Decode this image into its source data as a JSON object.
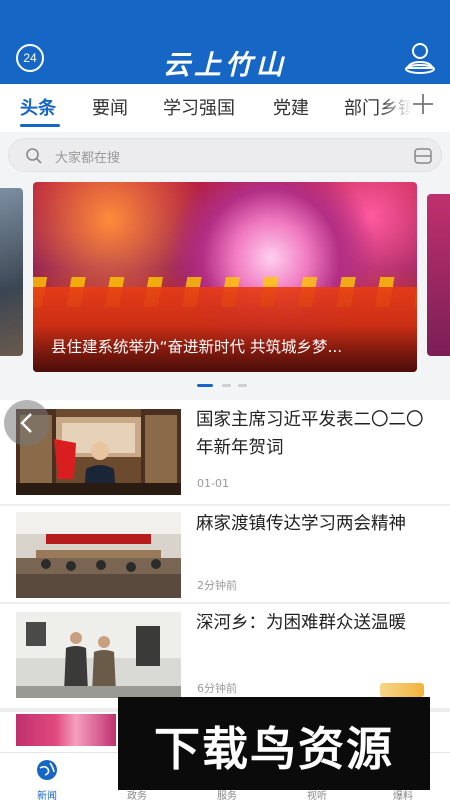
{
  "header": {
    "badge_text": "24",
    "title": "云上竹山",
    "user_icon": "user-profile-icon",
    "bg_color": "#1666c5"
  },
  "tabs": [
    {
      "label": "头条",
      "active": true
    },
    {
      "label": "要闻"
    },
    {
      "label": "学习强国"
    },
    {
      "label": "党建"
    },
    {
      "label": "部门乡镇"
    }
  ],
  "tabs_add_icon": "plus-icon",
  "search": {
    "placeholder": "大家都在搜"
  },
  "banner": {
    "title": "县住建系统举办“奋进新时代 共筑城乡梦...",
    "indicator": {
      "count": 3,
      "active": 0
    }
  },
  "news": [
    {
      "title": "国家主席习近平发表二〇二〇年新年贺词",
      "meta": "01-01"
    },
    {
      "title": "麻家渡镇传达学习两会精神",
      "meta": "2分钟前"
    },
    {
      "title": "深河乡：为困难群众送温暖",
      "meta": "6分钟前"
    }
  ],
  "bottom_nav": [
    {
      "label": "新闻",
      "icon": "globe-icon",
      "active": true
    },
    {
      "label": "政务",
      "icon": "gov-icon"
    },
    {
      "label": "服务",
      "icon": "service-icon"
    },
    {
      "label": "视听",
      "icon": "video-icon"
    },
    {
      "label": "爆料",
      "icon": "report-icon"
    }
  ],
  "watermark": "下载鸟资源"
}
